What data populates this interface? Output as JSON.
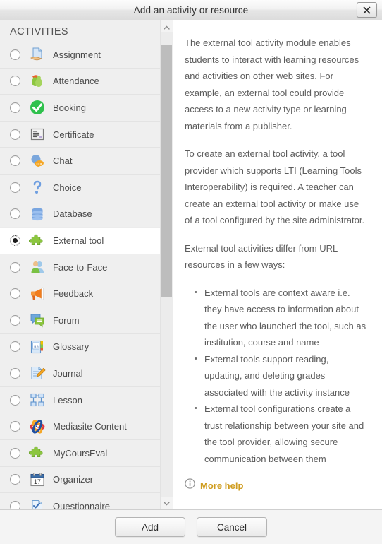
{
  "dialog": {
    "title": "Add an activity or resource",
    "close_label": "×",
    "close_icon": "close-icon"
  },
  "sidebar": {
    "heading": "ACTIVITIES",
    "scrollbar": {
      "up_icon": "chevron-up-icon",
      "down_icon": "chevron-down-icon"
    },
    "items": [
      {
        "label": "Assignment",
        "icon": "assignment-icon",
        "selected": false
      },
      {
        "label": "Attendance",
        "icon": "attendance-icon",
        "selected": false
      },
      {
        "label": "Booking",
        "icon": "booking-check-icon",
        "selected": false
      },
      {
        "label": "Certificate",
        "icon": "certificate-icon",
        "selected": false
      },
      {
        "label": "Chat",
        "icon": "chat-bubble-icon",
        "selected": false
      },
      {
        "label": "Choice",
        "icon": "choice-question-icon",
        "selected": false
      },
      {
        "label": "Database",
        "icon": "database-icon",
        "selected": false
      },
      {
        "label": "External tool",
        "icon": "puzzle-piece-icon",
        "selected": true
      },
      {
        "label": "Face-to-Face",
        "icon": "face-to-face-icon",
        "selected": false
      },
      {
        "label": "Feedback",
        "icon": "megaphone-icon",
        "selected": false
      },
      {
        "label": "Forum",
        "icon": "forum-icon",
        "selected": false
      },
      {
        "label": "Glossary",
        "icon": "glossary-icon",
        "selected": false
      },
      {
        "label": "Journal",
        "icon": "journal-pencil-icon",
        "selected": false
      },
      {
        "label": "Lesson",
        "icon": "lesson-flowchart-icon",
        "selected": false
      },
      {
        "label": "Mediasite Content",
        "icon": "mediasite-icon",
        "selected": false
      },
      {
        "label": "MyCoursEval",
        "icon": "puzzle-piece-icon",
        "selected": false
      },
      {
        "label": "Organizer",
        "icon": "calendar-icon",
        "selected": false
      },
      {
        "label": "Questionnaire",
        "icon": "questionnaire-icon",
        "selected": false
      }
    ]
  },
  "description": {
    "paragraphs": [
      "The external tool activity module enables students to interact with learning resources and activities on other web sites. For example, an external tool could provide access to a new activity type or learning materials from a publisher.",
      "To create an external tool activity, a tool provider which supports LTI (Learning Tools Interoperability) is required. A teacher can create an external tool activity or make use of a tool configured by the site administrator.",
      "External tool activities differ from URL resources in a few ways:"
    ],
    "bullets": [
      "External tools are context aware i.e. they have access to information about the user who launched the tool, such as institution, course and name",
      "External tools support reading, updating, and deleting grades associated with the activity instance",
      "External tool configurations create a trust relationship between your site and the tool provider, allowing secure communication between them"
    ],
    "more_help_label": "More help",
    "more_help_icon": "info-circle-icon",
    "more_help_color": "#cf9c1e"
  },
  "footer": {
    "add_label": "Add",
    "cancel_label": "Cancel"
  },
  "calendar_day": "17"
}
